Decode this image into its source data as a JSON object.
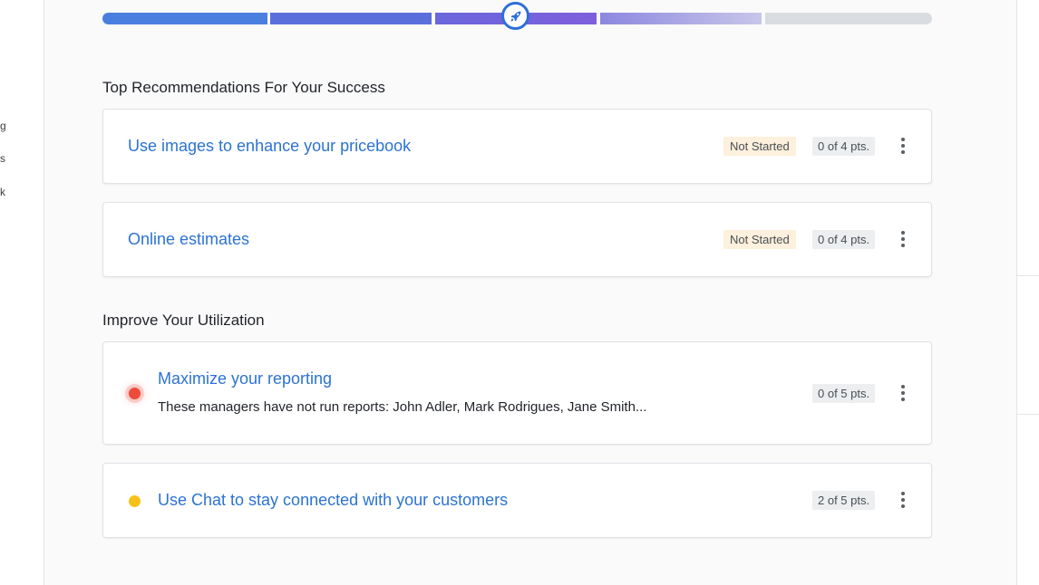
{
  "colors": {
    "link": "#2c73d2",
    "progress_blue": "#4a7fe0",
    "progress_purple": "#7e5fdc",
    "status_bg": "#fdf0dc",
    "priority_red": "#ee4c3b",
    "priority_yellow": "#f6c21a"
  },
  "left_sidebar": {
    "fragments": [
      "g",
      "s",
      "k"
    ]
  },
  "progress": {
    "marker_icon": "rocket-icon"
  },
  "sections": {
    "top": {
      "title": "Top Recommendations For Your Success",
      "cards": [
        {
          "label": "Use images to enhance your pricebook",
          "status": "Not Started",
          "points": "0 of 4 pts.",
          "menu_icon": "kebab-menu-icon"
        },
        {
          "label": "Online estimates",
          "status": "Not Started",
          "points": "0 of 4 pts.",
          "menu_icon": "kebab-menu-icon"
        }
      ]
    },
    "utilization": {
      "title": "Improve Your Utilization",
      "cards": [
        {
          "label": "Maximize your reporting",
          "description": "These managers have not run reports: John Adler, Mark Rodrigues, Jane Smith...",
          "points": "0 of 5 pts.",
          "priority": "high",
          "menu_icon": "kebab-menu-icon"
        },
        {
          "label": "Use Chat to stay connected with your customers",
          "points": "2 of 5 pts.",
          "priority": "medium",
          "menu_icon": "kebab-menu-icon"
        }
      ]
    }
  }
}
